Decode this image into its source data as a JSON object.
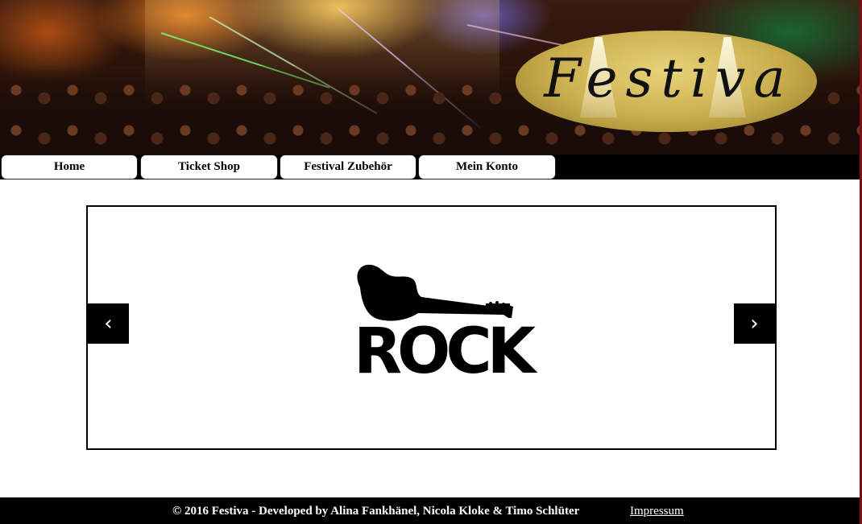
{
  "header": {
    "logo_text": "Festiva"
  },
  "nav": {
    "items": [
      {
        "label": "Home"
      },
      {
        "label": "Ticket Shop"
      },
      {
        "label": "Festival Zubehör"
      },
      {
        "label": "Mein Konto"
      }
    ]
  },
  "slider": {
    "image_alt": "ROCK",
    "prev_icon": "chevron-left-icon",
    "next_icon": "chevron-right-icon"
  },
  "footer": {
    "copyright": "© 2016 Festiva - Developed by Alina Fankhänel, Nicola Kloke & Timo Schlüter",
    "impressum": "Impressum"
  },
  "colors": {
    "nav_bg": "#000000",
    "footer_bg": "#000000",
    "accent_edge": "#7a0f16"
  }
}
